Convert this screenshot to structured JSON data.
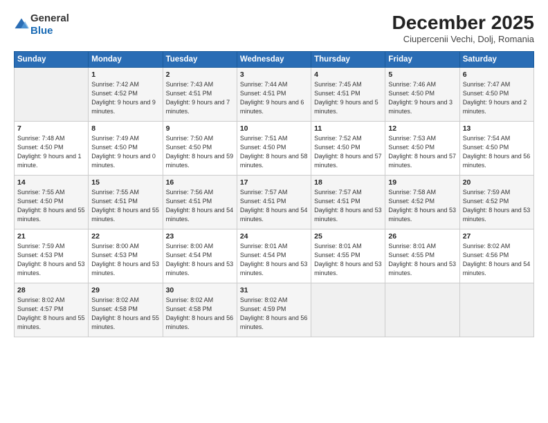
{
  "logo": {
    "general": "General",
    "blue": "Blue"
  },
  "title": "December 2025",
  "location": "Ciupercenii Vechi, Dolj, Romania",
  "headers": [
    "Sunday",
    "Monday",
    "Tuesday",
    "Wednesday",
    "Thursday",
    "Friday",
    "Saturday"
  ],
  "weeks": [
    [
      {
        "day": "",
        "sunrise": "",
        "sunset": "",
        "daylight": ""
      },
      {
        "day": "1",
        "sunrise": "Sunrise: 7:42 AM",
        "sunset": "Sunset: 4:52 PM",
        "daylight": "Daylight: 9 hours and 9 minutes."
      },
      {
        "day": "2",
        "sunrise": "Sunrise: 7:43 AM",
        "sunset": "Sunset: 4:51 PM",
        "daylight": "Daylight: 9 hours and 7 minutes."
      },
      {
        "day": "3",
        "sunrise": "Sunrise: 7:44 AM",
        "sunset": "Sunset: 4:51 PM",
        "daylight": "Daylight: 9 hours and 6 minutes."
      },
      {
        "day": "4",
        "sunrise": "Sunrise: 7:45 AM",
        "sunset": "Sunset: 4:51 PM",
        "daylight": "Daylight: 9 hours and 5 minutes."
      },
      {
        "day": "5",
        "sunrise": "Sunrise: 7:46 AM",
        "sunset": "Sunset: 4:50 PM",
        "daylight": "Daylight: 9 hours and 3 minutes."
      },
      {
        "day": "6",
        "sunrise": "Sunrise: 7:47 AM",
        "sunset": "Sunset: 4:50 PM",
        "daylight": "Daylight: 9 hours and 2 minutes."
      }
    ],
    [
      {
        "day": "7",
        "sunrise": "Sunrise: 7:48 AM",
        "sunset": "Sunset: 4:50 PM",
        "daylight": "Daylight: 9 hours and 1 minute."
      },
      {
        "day": "8",
        "sunrise": "Sunrise: 7:49 AM",
        "sunset": "Sunset: 4:50 PM",
        "daylight": "Daylight: 9 hours and 0 minutes."
      },
      {
        "day": "9",
        "sunrise": "Sunrise: 7:50 AM",
        "sunset": "Sunset: 4:50 PM",
        "daylight": "Daylight: 8 hours and 59 minutes."
      },
      {
        "day": "10",
        "sunrise": "Sunrise: 7:51 AM",
        "sunset": "Sunset: 4:50 PM",
        "daylight": "Daylight: 8 hours and 58 minutes."
      },
      {
        "day": "11",
        "sunrise": "Sunrise: 7:52 AM",
        "sunset": "Sunset: 4:50 PM",
        "daylight": "Daylight: 8 hours and 57 minutes."
      },
      {
        "day": "12",
        "sunrise": "Sunrise: 7:53 AM",
        "sunset": "Sunset: 4:50 PM",
        "daylight": "Daylight: 8 hours and 57 minutes."
      },
      {
        "day": "13",
        "sunrise": "Sunrise: 7:54 AM",
        "sunset": "Sunset: 4:50 PM",
        "daylight": "Daylight: 8 hours and 56 minutes."
      }
    ],
    [
      {
        "day": "14",
        "sunrise": "Sunrise: 7:55 AM",
        "sunset": "Sunset: 4:50 PM",
        "daylight": "Daylight: 8 hours and 55 minutes."
      },
      {
        "day": "15",
        "sunrise": "Sunrise: 7:55 AM",
        "sunset": "Sunset: 4:51 PM",
        "daylight": "Daylight: 8 hours and 55 minutes."
      },
      {
        "day": "16",
        "sunrise": "Sunrise: 7:56 AM",
        "sunset": "Sunset: 4:51 PM",
        "daylight": "Daylight: 8 hours and 54 minutes."
      },
      {
        "day": "17",
        "sunrise": "Sunrise: 7:57 AM",
        "sunset": "Sunset: 4:51 PM",
        "daylight": "Daylight: 8 hours and 54 minutes."
      },
      {
        "day": "18",
        "sunrise": "Sunrise: 7:57 AM",
        "sunset": "Sunset: 4:51 PM",
        "daylight": "Daylight: 8 hours and 53 minutes."
      },
      {
        "day": "19",
        "sunrise": "Sunrise: 7:58 AM",
        "sunset": "Sunset: 4:52 PM",
        "daylight": "Daylight: 8 hours and 53 minutes."
      },
      {
        "day": "20",
        "sunrise": "Sunrise: 7:59 AM",
        "sunset": "Sunset: 4:52 PM",
        "daylight": "Daylight: 8 hours and 53 minutes."
      }
    ],
    [
      {
        "day": "21",
        "sunrise": "Sunrise: 7:59 AM",
        "sunset": "Sunset: 4:53 PM",
        "daylight": "Daylight: 8 hours and 53 minutes."
      },
      {
        "day": "22",
        "sunrise": "Sunrise: 8:00 AM",
        "sunset": "Sunset: 4:53 PM",
        "daylight": "Daylight: 8 hours and 53 minutes."
      },
      {
        "day": "23",
        "sunrise": "Sunrise: 8:00 AM",
        "sunset": "Sunset: 4:54 PM",
        "daylight": "Daylight: 8 hours and 53 minutes."
      },
      {
        "day": "24",
        "sunrise": "Sunrise: 8:01 AM",
        "sunset": "Sunset: 4:54 PM",
        "daylight": "Daylight: 8 hours and 53 minutes."
      },
      {
        "day": "25",
        "sunrise": "Sunrise: 8:01 AM",
        "sunset": "Sunset: 4:55 PM",
        "daylight": "Daylight: 8 hours and 53 minutes."
      },
      {
        "day": "26",
        "sunrise": "Sunrise: 8:01 AM",
        "sunset": "Sunset: 4:55 PM",
        "daylight": "Daylight: 8 hours and 53 minutes."
      },
      {
        "day": "27",
        "sunrise": "Sunrise: 8:02 AM",
        "sunset": "Sunset: 4:56 PM",
        "daylight": "Daylight: 8 hours and 54 minutes."
      }
    ],
    [
      {
        "day": "28",
        "sunrise": "Sunrise: 8:02 AM",
        "sunset": "Sunset: 4:57 PM",
        "daylight": "Daylight: 8 hours and 55 minutes."
      },
      {
        "day": "29",
        "sunrise": "Sunrise: 8:02 AM",
        "sunset": "Sunset: 4:58 PM",
        "daylight": "Daylight: 8 hours and 55 minutes."
      },
      {
        "day": "30",
        "sunrise": "Sunrise: 8:02 AM",
        "sunset": "Sunset: 4:58 PM",
        "daylight": "Daylight: 8 hours and 56 minutes."
      },
      {
        "day": "31",
        "sunrise": "Sunrise: 8:02 AM",
        "sunset": "Sunset: 4:59 PM",
        "daylight": "Daylight: 8 hours and 56 minutes."
      },
      {
        "day": "",
        "sunrise": "",
        "sunset": "",
        "daylight": ""
      },
      {
        "day": "",
        "sunrise": "",
        "sunset": "",
        "daylight": ""
      },
      {
        "day": "",
        "sunrise": "",
        "sunset": "",
        "daylight": ""
      }
    ]
  ]
}
